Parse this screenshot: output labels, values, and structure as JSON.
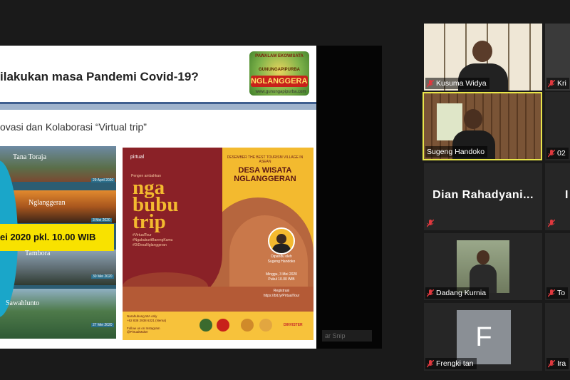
{
  "slide": {
    "title": "ilakukan masa Pandemi Covid-19?",
    "subtitle": "ovasi dan Kolaborasi “Virtual trip”",
    "logo": {
      "arc_text": "PAWALAM EKOWISATA",
      "middle_text": "GUNUNGAPIPURBA",
      "main_text": "NGLANGGERAN",
      "url": "www.gunungapipurba.com"
    },
    "collage": {
      "captions": [
        "Tana Toraja",
        "Nglanggeran",
        "Tambora",
        "Sawahlunto"
      ],
      "dates": [
        "29 April 2020",
        "3 Mei 2020",
        "30 Mei 2020",
        "27 Mei 2020"
      ],
      "banner": "ei 2020 pkl. 10.00 WIB"
    },
    "poster": {
      "brand": "pirtual",
      "presents_small": "Pengen ambahkan",
      "headline": "nga\nbubu\ntrip",
      "tags": "#VirtualTour\n#NgabuburitBarengKamu\n#DiDesaNglanggeran",
      "presents": "DESEMBER THE BEST TOURISM VILLAGE IN ASEAN",
      "title_line1": "DESA WISATA",
      "title_line2": "NGLANGGERAN",
      "host_label": "Dipandu oleh\nSugeng Handoko",
      "schedule": "Minggu, 3 Mei 2020\nPukul 10.00 WIB",
      "register": "Registrasi\nhttps://bit.ly/PirtualTour",
      "footer_text": "Narahubung WA only\n+62 838 2938 6321 (Nema)\n\nFollow us on Instagram\n@PirtualMaker",
      "sponsor_label": "DINVISTER"
    },
    "ghost_label": "ar Snip"
  },
  "participants": [
    {
      "name": "Kusuma Widya",
      "muted": true
    },
    {
      "name": "Kri",
      "muted": true
    },
    {
      "name": "Sugeng Handoko",
      "muted": false,
      "active_speaker": true
    },
    {
      "name": "02",
      "muted": true
    },
    {
      "name": "Dian  Rahadyani...",
      "display_name": "Dian  Rahadyani...",
      "muted": true
    },
    {
      "name": "I",
      "display_name": "I",
      "muted": true
    },
    {
      "name": "Dadang Kurnia",
      "muted": true
    },
    {
      "name": "To",
      "muted": true
    },
    {
      "name": "Frengki tan",
      "avatar_letter": "F",
      "muted": true
    },
    {
      "name": "Ira",
      "muted": true
    }
  ],
  "colors": {
    "background": "#1a1a1a",
    "tile": "#262626",
    "active_speaker_border": "#e8e54a",
    "muted_icon": "#e0383e",
    "banner_yellow": "#f8e200",
    "poster_maroon": "#8a2127",
    "poster_gold": "#f3ba2f"
  },
  "icons": {
    "muted_microphone": "mic-muted-icon"
  }
}
